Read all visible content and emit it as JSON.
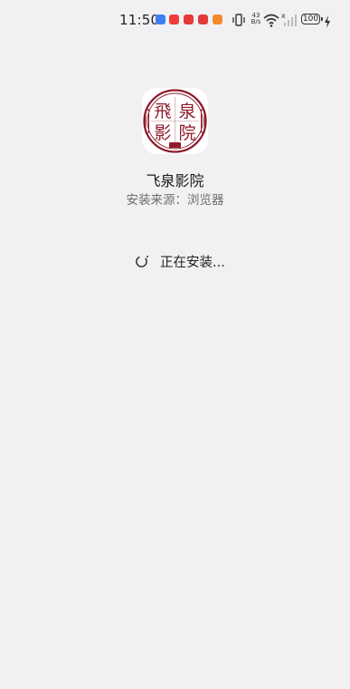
{
  "status_bar": {
    "time": "11:50",
    "network_speed_value": "43",
    "network_speed_unit": "B/s",
    "battery_level": "100",
    "notification_icons": [
      {
        "name": "message-app-icon",
        "color": "#3f7ff3"
      },
      {
        "name": "weibo-app-icon",
        "color": "#ef3b3b"
      },
      {
        "name": "video-app-icon",
        "color": "#e63a3a"
      },
      {
        "name": "game-app-icon",
        "color": "#e23a3a"
      },
      {
        "name": "player-app-icon",
        "color": "#f28a2d"
      }
    ]
  },
  "app": {
    "name": "飞泉影院",
    "source": "安装来源：浏览器",
    "icon_name": "feiquan-cinema-logo-icon",
    "logo_text": [
      "飛",
      "泉",
      "影",
      "院"
    ],
    "logo_color": "#8e1b2b"
  },
  "install": {
    "status_text": "正在安装...",
    "spinner_icon": "loading-spinner-icon"
  },
  "colors": {
    "background": "#f1f1f3",
    "primary_text": "#1a1a1a",
    "secondary_text": "#6e6e6e"
  }
}
